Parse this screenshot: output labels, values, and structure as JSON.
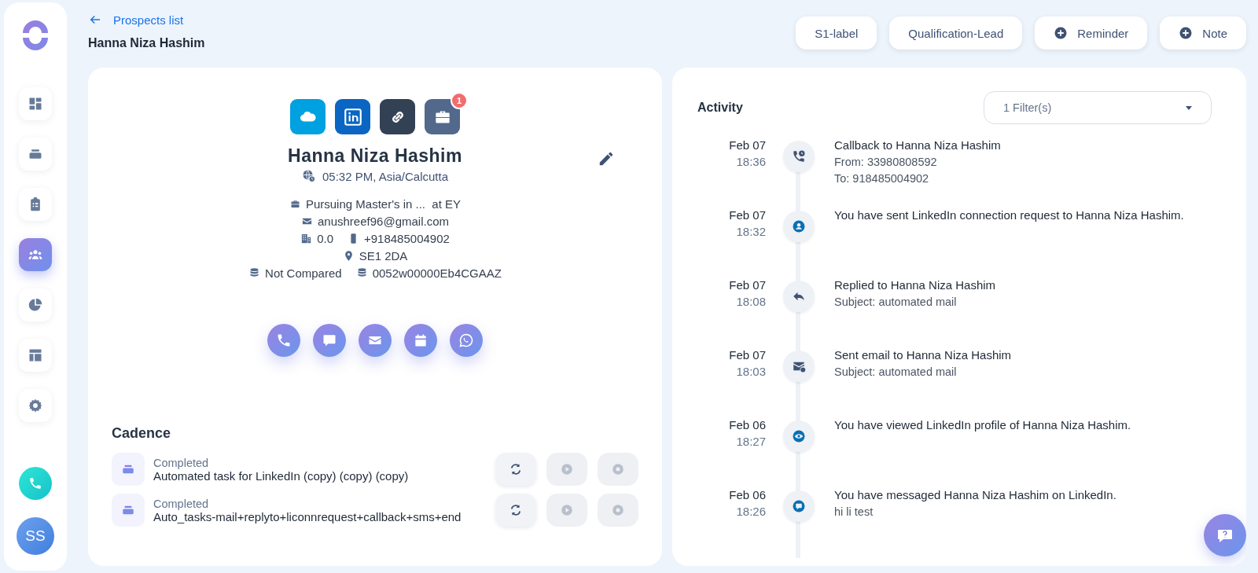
{
  "sidebar": {
    "items": [
      {
        "kind": "dashboard",
        "selected": false
      },
      {
        "kind": "stack",
        "selected": false
      },
      {
        "kind": "clipboard",
        "selected": false
      },
      {
        "kind": "people",
        "selected": true
      },
      {
        "kind": "pie",
        "selected": false
      },
      {
        "kind": "layout",
        "selected": false
      },
      {
        "kind": "gear",
        "selected": false
      }
    ],
    "avatar": "SS"
  },
  "header": {
    "back_link": "Prospects list",
    "title": "Hanna Niza Hashim",
    "buttons": [
      {
        "label": "S1-label",
        "kind": "plain"
      },
      {
        "label": "Qualification-Lead",
        "kind": "plain"
      },
      {
        "label": "Reminder",
        "kind": "add"
      },
      {
        "label": "Note",
        "kind": "add"
      }
    ]
  },
  "profile": {
    "links": [
      {
        "kind": "salesforce"
      },
      {
        "kind": "linkedin"
      },
      {
        "kind": "link"
      },
      {
        "kind": "briefcase",
        "badge": "1"
      }
    ],
    "name": "Hanna Niza Hashim",
    "local_time": "05:32 PM, Asia/Calcutta",
    "details": [
      [
        {
          "kind": "briefcase",
          "text": "Pursuing Master's in ...  at EY"
        }
      ],
      [
        {
          "kind": "email",
          "text": "anushreef96@gmail.com"
        }
      ],
      [
        {
          "kind": "building",
          "text": "0.0"
        },
        {
          "kind": "phone",
          "text": "+918485004902"
        }
      ],
      [
        {
          "kind": "pin",
          "text": "SE1 2DA"
        }
      ],
      [
        {
          "kind": "database",
          "text": "Not Compared"
        },
        {
          "kind": "database",
          "text": "0052w00000Eb4CGAAZ"
        }
      ]
    ],
    "actions": [
      {
        "kind": "call"
      },
      {
        "kind": "chat"
      },
      {
        "kind": "email"
      },
      {
        "kind": "calendar"
      },
      {
        "kind": "whatsapp"
      }
    ]
  },
  "cadence": {
    "title": "Cadence",
    "rows": [
      {
        "status": "Completed",
        "name": "Automated task for LinkedIn (copy) (copy) (copy)",
        "actions": [
          {
            "kind": "refresh",
            "disabled": false
          },
          {
            "kind": "play",
            "disabled": true
          },
          {
            "kind": "stop",
            "disabled": true
          }
        ]
      },
      {
        "status": "Completed",
        "name": "Auto_tasks-mail+replyto+liconnrequest+callback+sms+end",
        "actions": [
          {
            "kind": "refresh",
            "disabled": false
          },
          {
            "kind": "play",
            "disabled": true
          },
          {
            "kind": "stop",
            "disabled": true
          }
        ]
      }
    ]
  },
  "activity": {
    "title": "Activity",
    "filter": "1 Filter(s)",
    "items": [
      {
        "date": "Feb 07",
        "time": "18:36",
        "kind": "callback",
        "title": "Callback to Hanna Niza Hashim",
        "lines": [
          "From: 33980808592",
          "To: 918485004902"
        ]
      },
      {
        "date": "Feb 07",
        "time": "18:32",
        "kind": "person",
        "title": "You have sent LinkedIn connection request to Hanna Niza Hashim."
      },
      {
        "date": "Feb 07",
        "time": "18:08",
        "kind": "reply",
        "title": "Replied to Hanna Niza Hashim",
        "lines": [
          "Subject: automated mail"
        ]
      },
      {
        "date": "Feb 07",
        "time": "18:03",
        "kind": "email",
        "title": "Sent email to Hanna Niza Hashim",
        "lines": [
          "Subject: automated mail"
        ]
      },
      {
        "date": "Feb 06",
        "time": "18:27",
        "kind": "eye",
        "title": "You have viewed LinkedIn profile of Hanna Niza Hashim."
      },
      {
        "date": "Feb 06",
        "time": "18:26",
        "kind": "message",
        "title": "You have messaged Hanna Niza Hashim on LinkedIn.",
        "lines": [
          "hi li test"
        ]
      }
    ]
  }
}
